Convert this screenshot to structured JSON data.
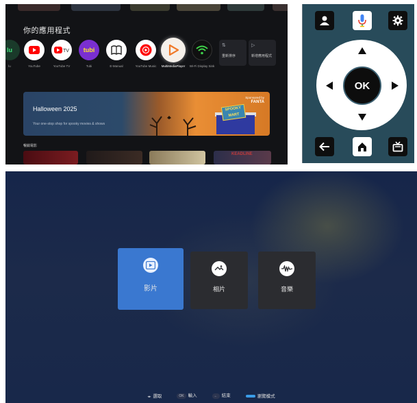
{
  "home": {
    "section_title": "你的應用程式",
    "apps": [
      {
        "label": "lu"
      },
      {
        "label": "YouTube"
      },
      {
        "label": "YouTube TV"
      },
      {
        "label": "Tubi"
      },
      {
        "label": "E-Manual"
      },
      {
        "label": "YouTube Music"
      },
      {
        "label": "MultiMediaPlayer"
      },
      {
        "label": "Wi-Fi Display Sink"
      }
    ],
    "small_tiles": [
      {
        "label": "重新排序"
      },
      {
        "label": "新增應用程式"
      }
    ],
    "banner": {
      "title": "Halloween 2025",
      "subtitle": "Your one-stop shop for spooky movies & shows",
      "sponsor_line1": "Sponsored by",
      "sponsor_brand": "FANTA",
      "sign": "SPOOKY MART"
    },
    "row2_title": "暢銷電影",
    "thumb_caption": "KEADLINE"
  },
  "remote": {
    "ok_label": "OK",
    "colors": {
      "background": "#284b5a",
      "button": "#0e0e0e",
      "dpad": "#ffffff"
    }
  },
  "media": {
    "tiles": [
      {
        "label": "影片",
        "selected": true
      },
      {
        "label": "相片",
        "selected": false
      },
      {
        "label": "音樂",
        "selected": false
      }
    ],
    "hints": [
      {
        "key": "◂▸",
        "label": "選取"
      },
      {
        "key": "OK",
        "label": "輸入"
      },
      {
        "key": "←",
        "label": "結束"
      },
      {
        "key": "",
        "label": "瀏覽模式"
      }
    ],
    "colors": {
      "selected": "#3a78d0",
      "tile": "#2b2c30"
    }
  }
}
